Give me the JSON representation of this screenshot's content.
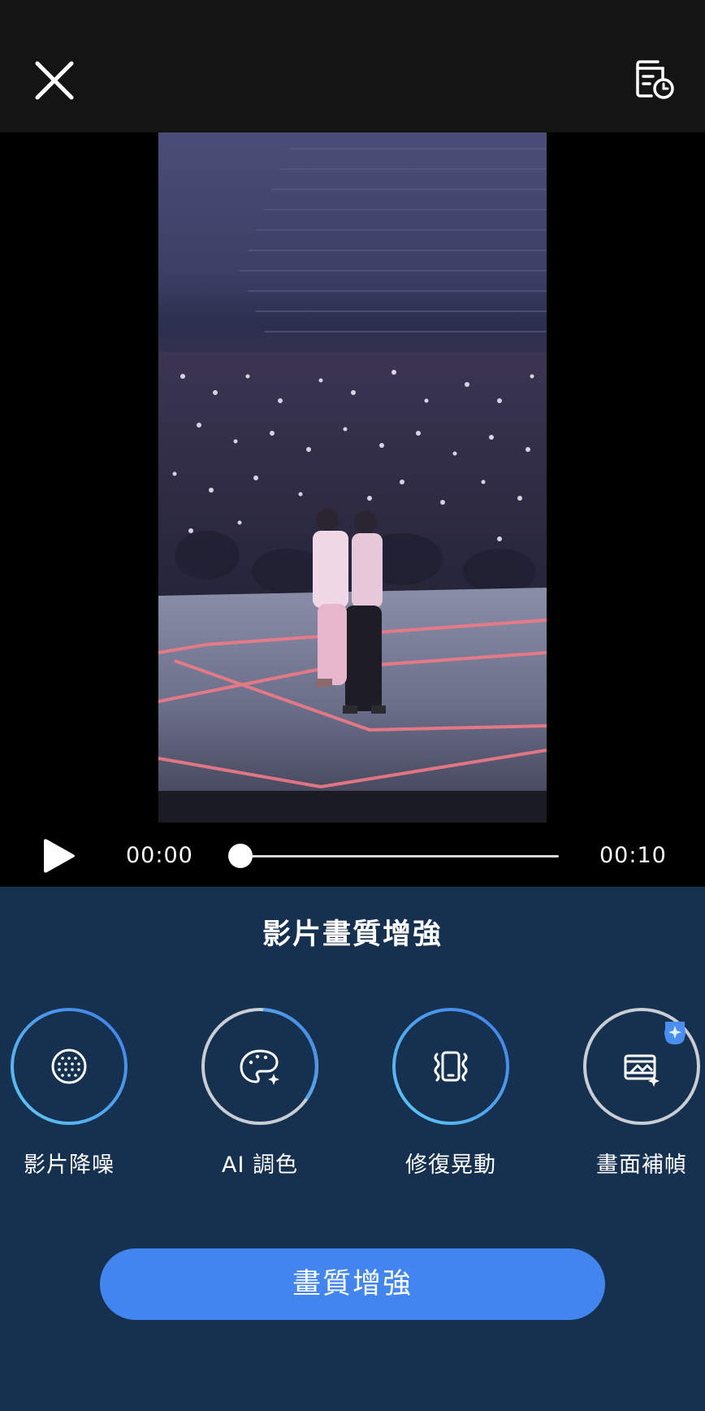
{
  "header": {
    "close_icon": "close-icon",
    "history_icon": "history-document-icon"
  },
  "player": {
    "current_time": "00:00",
    "total_time": "00:10",
    "progress": 0,
    "play_icon": "play-icon"
  },
  "panel": {
    "title": "影片畫質增強",
    "tools": [
      {
        "label": "影片降噪",
        "icon": "noise-reduction-icon"
      },
      {
        "label": "AI 調色",
        "icon": "palette-sparkle-icon"
      },
      {
        "label": "修復晃動",
        "icon": "stabilize-phone-icon"
      },
      {
        "label": "畫面補幀",
        "icon": "frame-interpolation-icon",
        "badge_icon": "premium-badge-icon"
      }
    ],
    "cta_label": "畫質增強"
  },
  "colors": {
    "panel_bg": "#16304f",
    "accent_blue": "#4385ef",
    "ring_gradient_start": "#5fc8f5",
    "ring_gradient_end": "#3f7ee8",
    "ring_grey": "#c9cdd4",
    "badge_bg": "#4a8ff0"
  }
}
